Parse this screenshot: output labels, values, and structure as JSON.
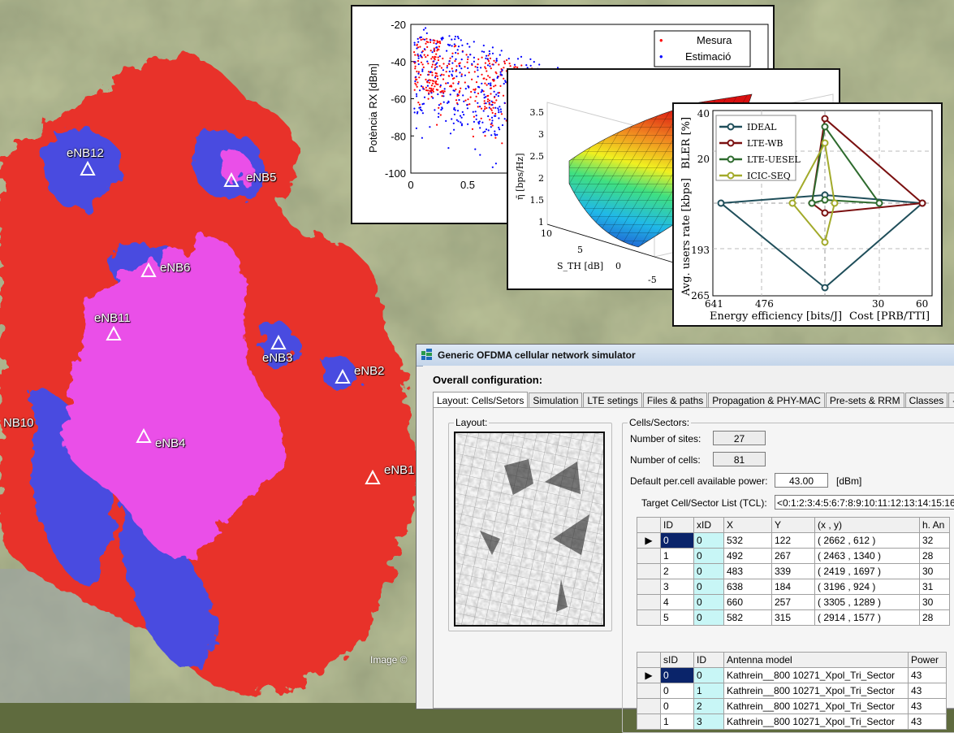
{
  "map": {
    "credit": "Image ©",
    "stations": [
      {
        "label": "eNB12"
      },
      {
        "label": "eNB5"
      },
      {
        "label": "eNB6"
      },
      {
        "label": "eNB11"
      },
      {
        "label": "eNB3"
      },
      {
        "label": "eNB2"
      },
      {
        "label": "eNB4"
      },
      {
        "label": "NB10"
      },
      {
        "label": "eNB1"
      }
    ]
  },
  "plot_rx": {
    "ylabel": "Potència RX [dBm]",
    "yticks": [
      "-20",
      "-40",
      "-60",
      "-80",
      "-100"
    ],
    "xticks": [
      "0",
      "0.5"
    ],
    "legend": [
      "Mesura",
      "Estimació"
    ],
    "colors": {
      "measure": "#ff0000",
      "estimate": "#0000ff"
    }
  },
  "plot_3d": {
    "zlabel": "η̄ [bps/Hz]",
    "zticks": [
      "3.5",
      "3",
      "2.5",
      "2",
      "1.5",
      "1"
    ],
    "xlabel": "S_TH [dB]",
    "xticks": [
      "10",
      "5",
      "0",
      "-5"
    ]
  },
  "plot_radar": {
    "legend": [
      "IDEAL",
      "LTE-WB",
      "LTE-UESEL",
      "ICIC-SEQ"
    ],
    "colors": [
      "#1f4e5a",
      "#7a1010",
      "#2e6b2e",
      "#a2aa2a"
    ],
    "axis_top": "BLER [%]",
    "axis_left": "Avg. users rate [kbps]",
    "axis_bottom_left": "Energy efficiency [bits/J]",
    "axis_bottom_right": "Cost [PRB/TTI]",
    "ticks": {
      "top_max": "40",
      "top_mid": "20",
      "left_mid": "193",
      "left_max": "265",
      "bottom_a": "641",
      "bottom_b": "476",
      "bottom_c": "30",
      "bottom_d": "60"
    }
  },
  "sim": {
    "title": "Generic OFDMA cellular network simulator",
    "heading": "Overall configuration:",
    "tabs": [
      "Layout: Cells/Setors",
      "Simulation",
      "LTE setings",
      "Files & paths",
      "Propagation & PHY-MAC",
      "Pre-sets & RRM",
      "Classes",
      "-"
    ],
    "layout_group": "Layout:",
    "cells_group": "Cells/Sectors:",
    "num_sites_label": "Number of sites:",
    "num_sites": "27",
    "num_cells_label": "Number of cells:",
    "num_cells": "81",
    "power_label": "Default per.cell available power:",
    "power_value": "43.00",
    "power_unit": "[dBm]",
    "tcl_label": "Target Cell/Sector List (TCL):",
    "tcl_value": "<0:1:2:3:4:5:6:7:8:9:10:11:12:13:14:15:16",
    "sites_table": {
      "headers": [
        "ID",
        "xID",
        "X",
        "Y",
        "(x , y)",
        "h. An"
      ],
      "rows": [
        [
          "0",
          "0",
          "532",
          "122",
          "( 2662 , 612 )",
          "32"
        ],
        [
          "1",
          "0",
          "492",
          "267",
          "( 2463 , 1340 )",
          "28"
        ],
        [
          "2",
          "0",
          "483",
          "339",
          "( 2419 , 1697 )",
          "30"
        ],
        [
          "3",
          "0",
          "638",
          "184",
          "( 3196 , 924 )",
          "31"
        ],
        [
          "4",
          "0",
          "660",
          "257",
          "( 3305 , 1289 )",
          "30"
        ],
        [
          "5",
          "0",
          "582",
          "315",
          "( 2914 , 1577 )",
          "28"
        ]
      ]
    },
    "sectors_table": {
      "headers": [
        "sID",
        "ID",
        "Antenna model",
        "Power"
      ],
      "rows": [
        [
          "0",
          "0",
          "Kathrein__800 10271_Xpol_Tri_Sector",
          "43"
        ],
        [
          "0",
          "1",
          "Kathrein__800 10271_Xpol_Tri_Sector",
          "43"
        ],
        [
          "0",
          "2",
          "Kathrein__800 10271_Xpol_Tri_Sector",
          "43"
        ],
        [
          "1",
          "3",
          "Kathrein__800 10271_Xpol_Tri_Sector",
          "43"
        ]
      ]
    }
  }
}
